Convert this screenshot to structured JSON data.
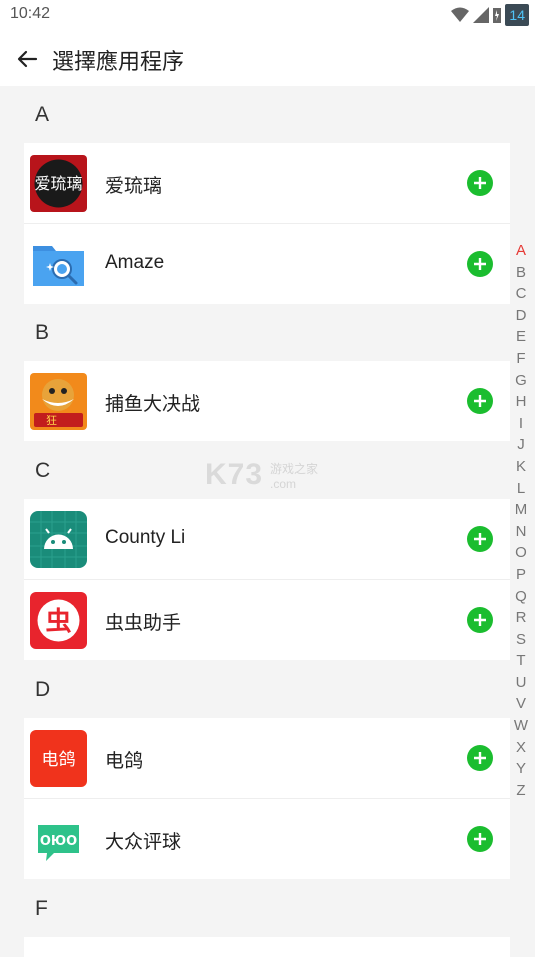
{
  "status": {
    "time": "10:42",
    "battery": "14"
  },
  "appbar": {
    "title": "選擇應用程序"
  },
  "sections": [
    {
      "letter": "A",
      "apps": [
        {
          "name": "爱琉璃"
        },
        {
          "name": "Amaze"
        }
      ]
    },
    {
      "letter": "B",
      "apps": [
        {
          "name": "捕鱼大决战"
        }
      ]
    },
    {
      "letter": "C",
      "apps": [
        {
          "name": "County Li"
        },
        {
          "name": "虫虫助手"
        }
      ]
    },
    {
      "letter": "D",
      "apps": [
        {
          "name": "电鸽"
        },
        {
          "name": "大众评球"
        }
      ]
    },
    {
      "letter": "F",
      "apps": []
    }
  ],
  "icons": {
    "ailiuli_text": "爱琉璃",
    "chongchong_text": "虫",
    "diange_text": "电鸽",
    "dazhong_text": "ОЮО",
    "buyu_text": "狂"
  },
  "alpha_index": [
    "A",
    "B",
    "C",
    "D",
    "E",
    "F",
    "G",
    "H",
    "I",
    "J",
    "K",
    "L",
    "M",
    "N",
    "O",
    "P",
    "Q",
    "R",
    "S",
    "T",
    "U",
    "V",
    "W",
    "X",
    "Y",
    "Z"
  ],
  "watermark": {
    "main": "K73",
    "sub": "游戏之家",
    "domain": ".com"
  },
  "colors": {
    "accent_green": "#1bbd2f",
    "index_active": "#e53935"
  }
}
